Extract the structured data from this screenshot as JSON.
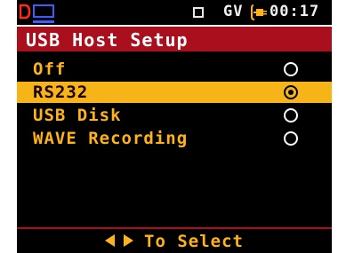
{
  "status_bar": {
    "gv_text": "GV",
    "time": "00:17",
    "icons": [
      "d-shape-icon",
      "usb-screen-icon",
      "square-icon",
      "charge-plug-icon"
    ]
  },
  "title": "USB Host Setup",
  "menu": {
    "items": [
      {
        "label": "Off",
        "selected": false
      },
      {
        "label": "RS232",
        "selected": true
      },
      {
        "label": "USB Disk",
        "selected": false
      },
      {
        "label": "WAVE Recording",
        "selected": false
      }
    ]
  },
  "footer": {
    "hint": "To Select",
    "icons": [
      "arrow-left-icon",
      "arrow-right-icon"
    ]
  },
  "colors": {
    "background": "#000000",
    "title_bar": "#aa0f1e",
    "highlight": "#f7b418",
    "menu_text": "#ffb319",
    "status_text": "#f0f0f0"
  }
}
